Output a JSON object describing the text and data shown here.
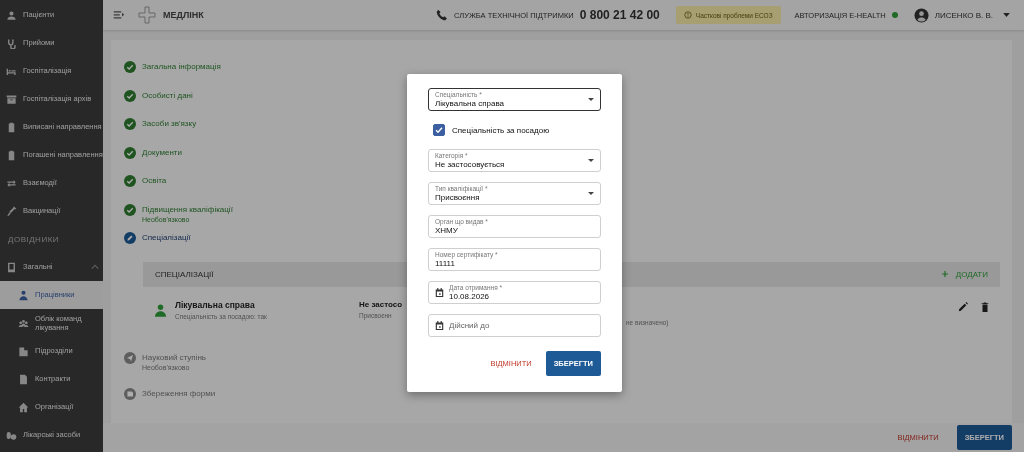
{
  "sidebar": {
    "items": [
      {
        "kind": "item",
        "label": "Пацієнти",
        "selected": false
      },
      {
        "kind": "item",
        "label": "Прийоми",
        "selected": false
      },
      {
        "kind": "item",
        "label": "Госпіталізація",
        "selected": false
      },
      {
        "kind": "item",
        "label": "Госпіталізація архів",
        "selected": false
      },
      {
        "kind": "item",
        "label": "Виписані направлення",
        "selected": false
      },
      {
        "kind": "item",
        "label": "Погашені направлення",
        "selected": false
      },
      {
        "kind": "item",
        "label": "Взаємодії",
        "selected": false
      },
      {
        "kind": "item",
        "label": "Вакцинації",
        "selected": false
      },
      {
        "kind": "header",
        "label": "ДОВІДНИКИ"
      },
      {
        "kind": "group",
        "label": "Загальні",
        "expanded": true,
        "children": [
          {
            "label": "Працівники",
            "selected": true
          },
          {
            "label": "Облік команд лікування",
            "selected": false
          },
          {
            "label": "Підрозділи",
            "selected": false
          },
          {
            "label": "Контракти",
            "selected": false
          },
          {
            "label": "Організації",
            "selected": false
          }
        ]
      },
      {
        "kind": "item",
        "label": "Лікарські засоби",
        "selected": false
      }
    ]
  },
  "header": {
    "brand": "МЕДЛІНК",
    "support_label": "СЛУЖБА ТЕХНІЧНОЇ ПІДТРИМКИ",
    "support_phone": "0 800 21 42 00",
    "notice": "Часткові проблеми ЕСОЗ",
    "auth_label": "АВТОРИЗАЦІЯ E-HEALTH",
    "auth_online": true,
    "user": "ЛИСЕНКО В. В."
  },
  "steps": [
    {
      "label": "Загальна інформація",
      "completed": true,
      "selected": false
    },
    {
      "label": "Особисті дані",
      "completed": true,
      "selected": false
    },
    {
      "label": "Засоби зв'язку",
      "completed": true,
      "selected": false
    },
    {
      "label": "Документи",
      "completed": true,
      "selected": false
    },
    {
      "label": "Освіта",
      "completed": true,
      "selected": false
    },
    {
      "label": "Підвищення кваліфікації",
      "subtitle": "Необов'язково",
      "completed": true,
      "selected": false
    },
    {
      "label": "Спеціалізації",
      "completed": false,
      "selected": true
    }
  ],
  "specializations": {
    "title": "СПЕЦІАЛІЗАЦІЇ",
    "add_label": "ДОДАТИ",
    "rows": [
      {
        "name": "Лікувальна справа",
        "note": "Спеціальність за посадою: так",
        "column_2_title": "Не застосо",
        "column_2_note": "Присвоєнн",
        "column_3_note": "не визначено)"
      }
    ]
  },
  "later_steps": [
    {
      "label": "Науковий ступінь",
      "subtitle": "Необов'язково",
      "completed": false,
      "selected": false
    },
    {
      "label": "Збереження форми",
      "completed": false,
      "selected": false
    }
  ],
  "footer": {
    "cancel": "ВІДМІНИТИ",
    "save": "ЗБЕРЕГТИ"
  },
  "dialog": {
    "fields": [
      {
        "kind": "select",
        "label": "Спеціальність *",
        "value": "Лікувальна справа",
        "focused": true
      },
      {
        "kind": "checkbox",
        "label": "Спеціальність за посадою",
        "checked": true
      },
      {
        "kind": "select",
        "label": "Категорія *",
        "value": "Не застосовується",
        "focused": false
      },
      {
        "kind": "select",
        "label": "Тип кваліфікації *",
        "value": "Присвоєння",
        "focused": false
      },
      {
        "kind": "text",
        "label": "Орган що видав *",
        "value": "ХНМУ",
        "focused": false
      },
      {
        "kind": "text",
        "label": "Номер сертифікату *",
        "value": "11111",
        "focused": false
      },
      {
        "kind": "date",
        "label": "Дата отримання *",
        "value": "10.08.2026",
        "focused": false
      },
      {
        "kind": "date",
        "placeholder": "Дійсний до",
        "focused": false
      }
    ],
    "cancel": "ВІДМІНИТИ",
    "save": "ЗБЕРЕГТИ"
  }
}
